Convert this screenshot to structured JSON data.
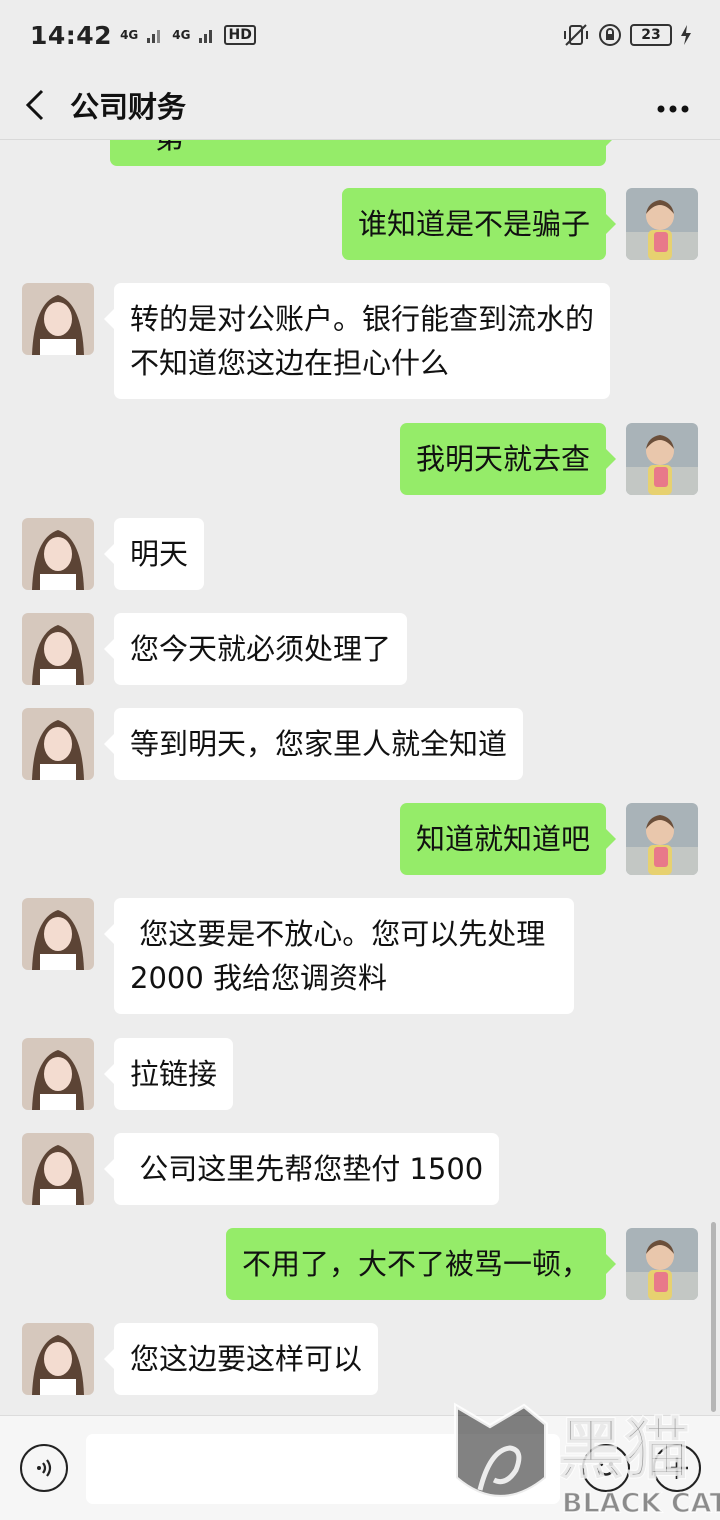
{
  "status_bar": {
    "time": "14:42",
    "net1": "4G",
    "net2": "4G",
    "hd": "HD",
    "battery": "23"
  },
  "header": {
    "title": "公司财务",
    "back_icon": "chevron-left-icon",
    "more_icon": "more-horizontal-icon"
  },
  "messages": [
    {
      "side": "right",
      "text": "一第"
    },
    {
      "side": "right",
      "text": "谁知道是不是骗子"
    },
    {
      "side": "left",
      "text": "转的是对公账户。银行能查到流水的 不知道您这边在担心什么"
    },
    {
      "side": "right",
      "text": "我明天就去查"
    },
    {
      "side": "left",
      "text": "明天"
    },
    {
      "side": "left",
      "text": "您今天就必须处理了"
    },
    {
      "side": "left",
      "text": "等到明天，您家里人就全知道"
    },
    {
      "side": "right",
      "text": "知道就知道吧"
    },
    {
      "side": "left",
      "text": " 您这要是不放心。您可以先处理2000 我给您调资料"
    },
    {
      "side": "left",
      "text": "拉链接"
    },
    {
      "side": "left",
      "text": " 公司这里先帮您垫付 1500"
    },
    {
      "side": "right",
      "text": "不用了，大不了被骂一顿，"
    },
    {
      "side": "left",
      "text": "您这边要这样可以"
    }
  ],
  "input_bar": {
    "voice_icon": "voice-icon",
    "emoji_icon": "emoji-icon",
    "plus_icon": "plus-icon",
    "value": ""
  },
  "watermark": {
    "text_cn": "黑猫",
    "text_en": "BLACK CAT"
  },
  "colors": {
    "background": "#ededed",
    "bubble_sent": "#95ec69",
    "bubble_received": "#ffffff"
  }
}
